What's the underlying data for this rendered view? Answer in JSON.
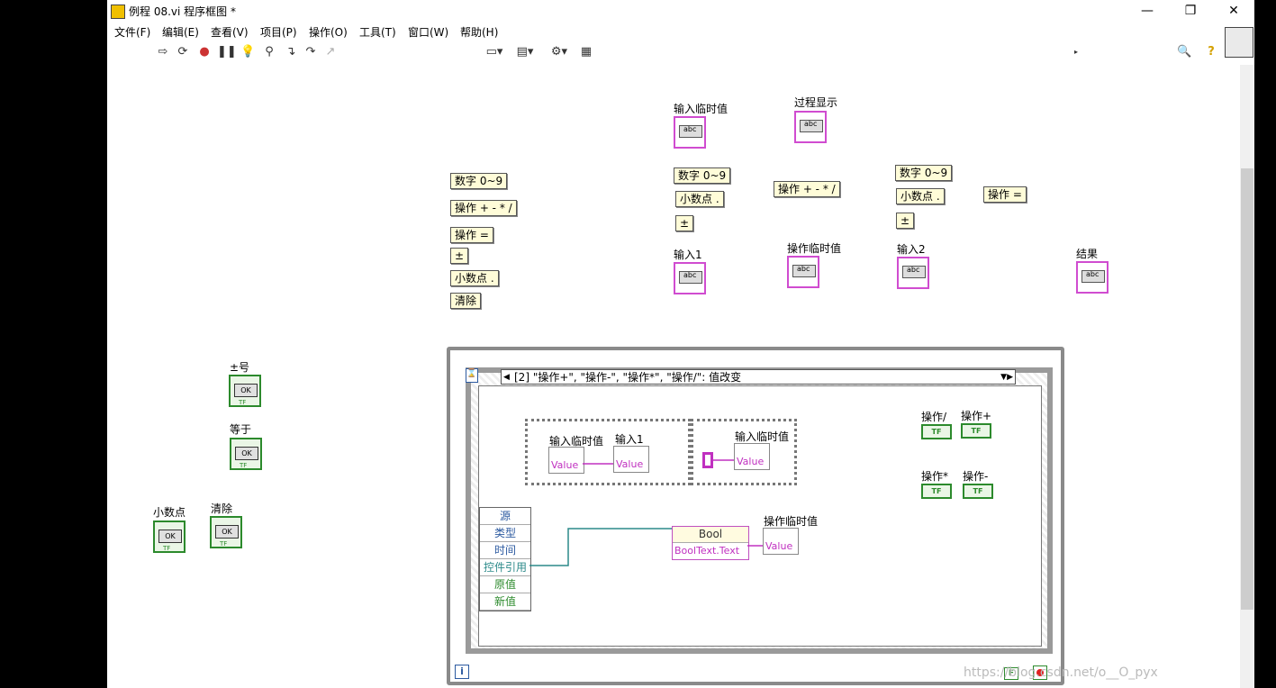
{
  "window": {
    "title": "例程 08.vi 程序框图 *",
    "controls": {
      "minimize": "—",
      "restore": "❐",
      "close": "✕"
    }
  },
  "menubar": [
    "文件(F)",
    "编辑(E)",
    "查看(V)",
    "项目(P)",
    "操作(O)",
    "工具(T)",
    "窗口(W)",
    "帮助(H)"
  ],
  "toolbar": {
    "font": "17pt 应用程序字体",
    "search_placeholder": "搜索",
    "help": "?"
  },
  "constants_left": [
    "数字 0~9",
    "操作 + - * /",
    "操作 =",
    "±",
    "小数点 .",
    "清除"
  ],
  "constants_mid": [
    "数字 0~9",
    "小数点 .",
    "±"
  ],
  "const_op": "操作 + - * /",
  "constants_right": [
    "数字 0~9",
    "小数点 .",
    "±"
  ],
  "const_eq": "操作 =",
  "indicators": {
    "input_temp": "输入临时值",
    "process_display": "过程显示",
    "input1": "输入1",
    "op_temp": "操作临时值",
    "input2": "输入2",
    "result": "结果",
    "abc": "abc"
  },
  "bool_controls": {
    "pm": "±号",
    "eq": "等于",
    "dot": "小数点",
    "clear": "清除",
    "ok": "OK",
    "tf": "TF"
  },
  "event_case": "[2] \"操作+\", \"操作-\", \"操作*\", \"操作/\": 值改变",
  "event_fields": [
    "源",
    "类型",
    "时间",
    "控件引用",
    "原值",
    "新值"
  ],
  "seq_nodes": {
    "n1": "输入临时值",
    "n2": "输入1",
    "n3": "输入临时值",
    "value": "Value"
  },
  "prop_node": {
    "class": "Bool",
    "property": "BoolText.Text"
  },
  "op_temp_label": "操作临时值",
  "op_buttons": {
    "div": "操作/",
    "add": "操作+",
    "mul": "操作*",
    "sub": "操作-",
    "tf": "TF"
  },
  "loop": {
    "info": "i",
    "stop": "F"
  },
  "watermark": "https://blog.csdn.net/o__O_pyx"
}
